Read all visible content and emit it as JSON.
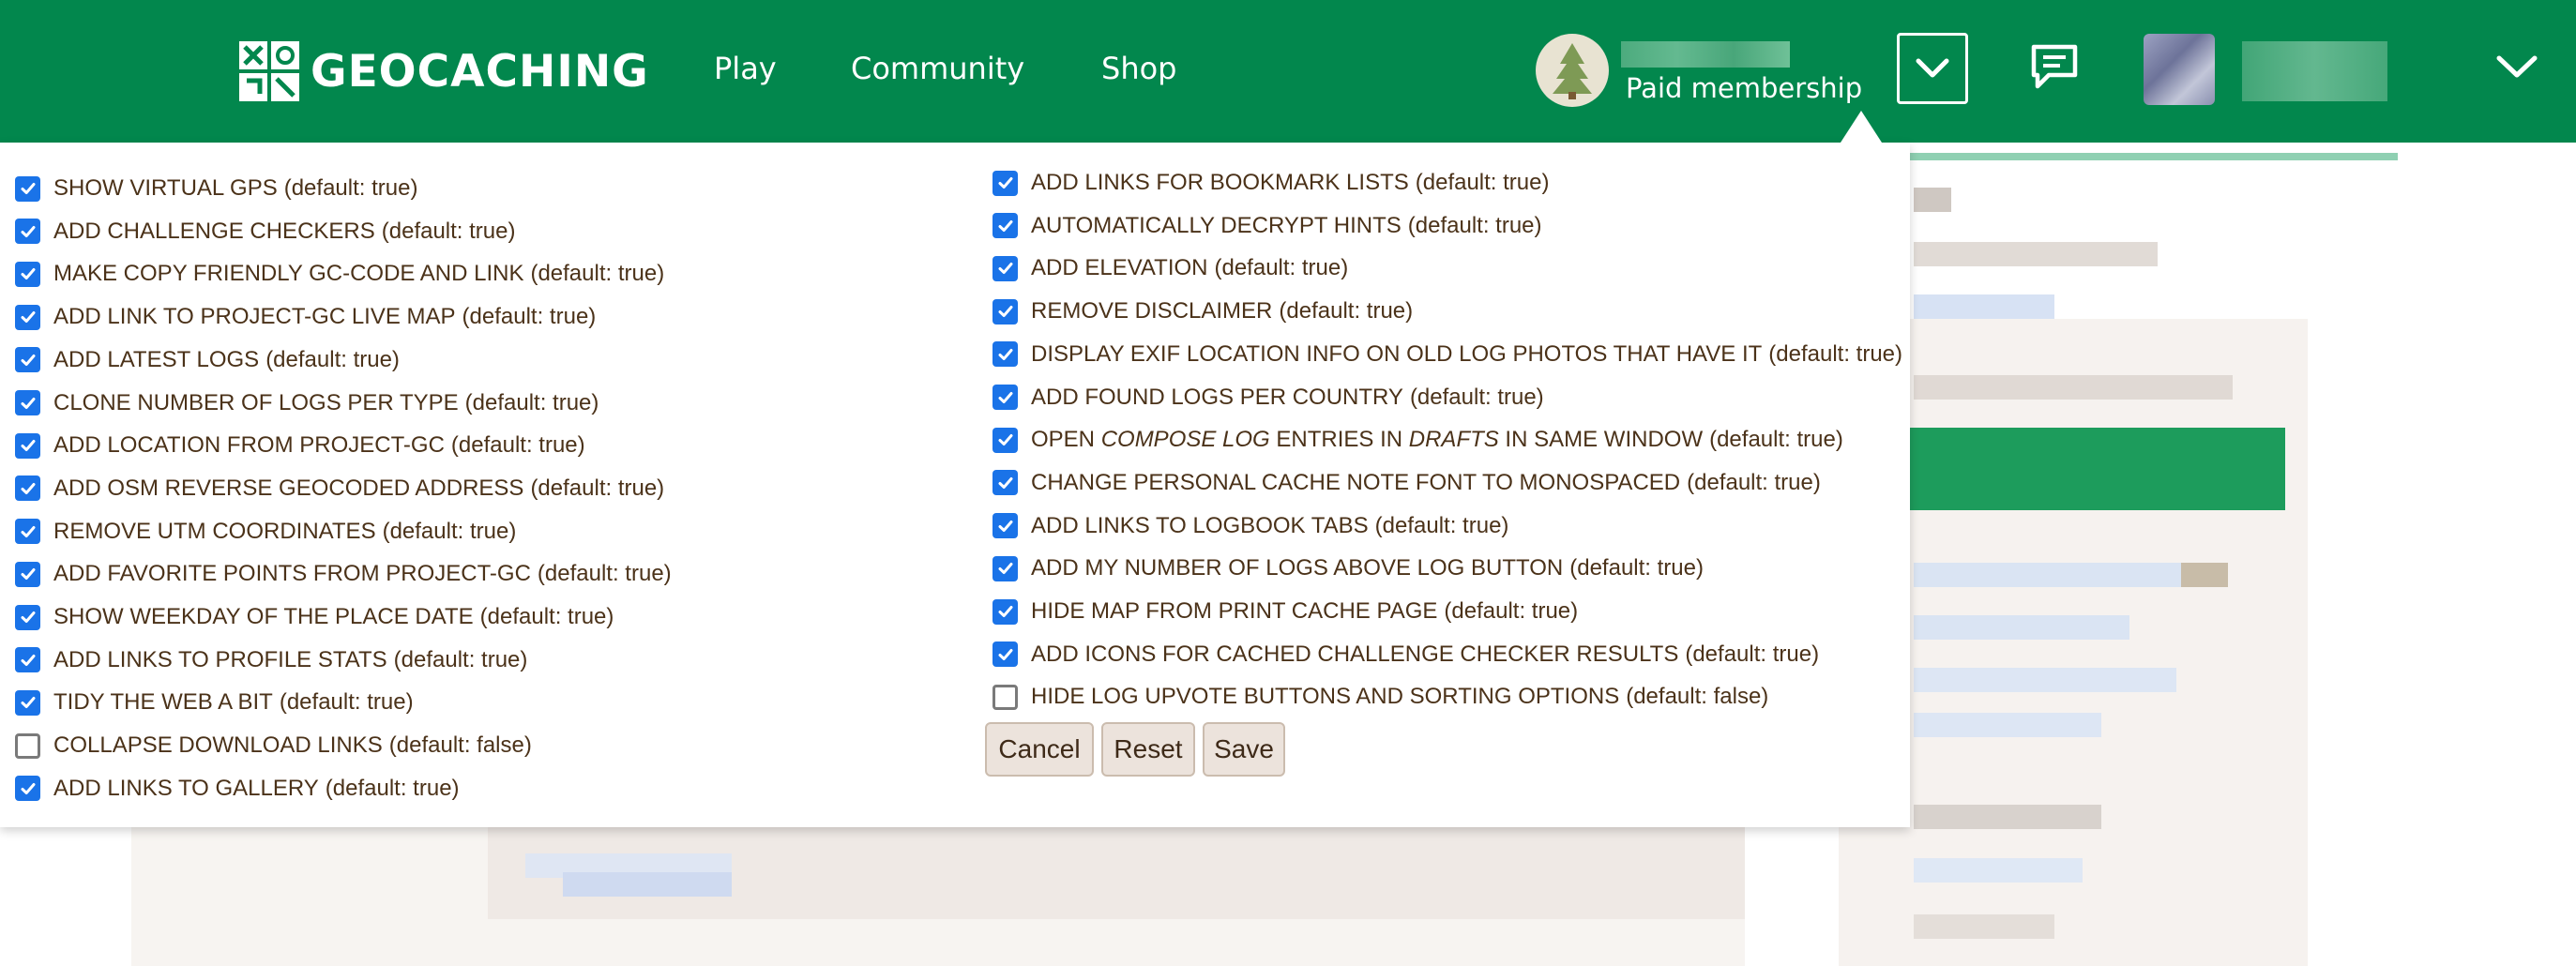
{
  "header": {
    "logo_text": "GEOCACHING",
    "nav": [
      "Play",
      "Community",
      "Shop"
    ],
    "membership": "Paid membership"
  },
  "left_options": [
    {
      "label": "SHOW VIRTUAL GPS",
      "default": "(default: true)",
      "checked": true
    },
    {
      "label": "ADD CHALLENGE CHECKERS",
      "default": "(default: true)",
      "checked": true
    },
    {
      "label": "MAKE COPY FRIENDLY GC-CODE AND LINK",
      "default": "(default: true)",
      "checked": true
    },
    {
      "label": "ADD LINK TO PROJECT-GC LIVE MAP",
      "default": "(default: true)",
      "checked": true
    },
    {
      "label": "ADD LATEST LOGS",
      "default": "(default: true)",
      "checked": true
    },
    {
      "label": "CLONE NUMBER OF LOGS PER TYPE",
      "default": "(default: true)",
      "checked": true
    },
    {
      "label": "ADD LOCATION FROM PROJECT-GC",
      "default": "(default: true)",
      "checked": true
    },
    {
      "label": "ADD OSM REVERSE GEOCODED ADDRESS",
      "default": "(default: true)",
      "checked": true
    },
    {
      "label": "REMOVE UTM COORDINATES",
      "default": "(default: true)",
      "checked": true
    },
    {
      "label": "ADD FAVORITE POINTS FROM PROJECT-GC",
      "default": "(default: true)",
      "checked": true
    },
    {
      "label": "SHOW WEEKDAY OF THE PLACE DATE",
      "default": "(default: true)",
      "checked": true
    },
    {
      "label": "ADD LINKS TO PROFILE STATS",
      "default": "(default: true)",
      "checked": true
    },
    {
      "label": "TIDY THE WEB A BIT",
      "default": "(default: true)",
      "checked": true
    },
    {
      "label": "COLLAPSE DOWNLOAD LINKS",
      "default": "(default: false)",
      "checked": false
    },
    {
      "label": "ADD LINKS TO GALLERY",
      "default": "(default: true)",
      "checked": true
    }
  ],
  "right_options": [
    {
      "label": "ADD LINKS FOR BOOKMARK LISTS",
      "default": "(default: true)",
      "checked": true
    },
    {
      "label": "AUTOMATICALLY DECRYPT HINTS",
      "default": "(default: true)",
      "checked": true
    },
    {
      "label": "ADD ELEVATION",
      "default": "(default: true)",
      "checked": true
    },
    {
      "label": "REMOVE DISCLAIMER",
      "default": "(default: true)",
      "checked": true
    },
    {
      "label": "DISPLAY EXIF LOCATION INFO ON OLD LOG PHOTOS THAT HAVE IT",
      "default": "(default: true)",
      "checked": true
    },
    {
      "label": "ADD FOUND LOGS PER COUNTRY",
      "default": "(default: true)",
      "checked": true
    },
    {
      "label_parts": [
        "OPEN ",
        "COMPOSE LOG",
        " ENTRIES IN ",
        "DRAFTS",
        " IN SAME WINDOW"
      ],
      "default": "(default: true)",
      "checked": true
    },
    {
      "label": "CHANGE PERSONAL CACHE NOTE FONT TO MONOSPACED",
      "default": "(default: true)",
      "checked": true
    },
    {
      "label": "ADD LINKS TO LOGBOOK TABS",
      "default": "(default: true)",
      "checked": true
    },
    {
      "label": "ADD MY NUMBER OF LOGS ABOVE LOG BUTTON",
      "default": "(default: true)",
      "checked": true
    },
    {
      "label": "HIDE MAP FROM PRINT CACHE PAGE",
      "default": "(default: true)",
      "checked": true
    },
    {
      "label": "ADD ICONS FOR CACHED CHALLENGE CHECKER RESULTS",
      "default": "(default: true)",
      "checked": true
    },
    {
      "label": "HIDE LOG UPVOTE BUTTONS AND SORTING OPTIONS",
      "default": "(default: false)",
      "checked": false
    }
  ],
  "buttons": {
    "cancel": "Cancel",
    "reset": "Reset",
    "save": "Save"
  },
  "colors": {
    "brand_green": "#02874d",
    "checkbox_blue": "#1a73e8",
    "label_brown": "#4b3219"
  }
}
